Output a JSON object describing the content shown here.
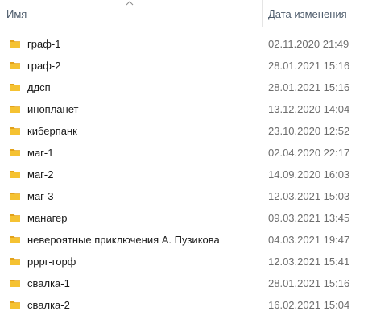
{
  "header": {
    "name_label": "Имя",
    "date_label": "Дата изменения",
    "sort_icon": "chevron-up-icon"
  },
  "colors": {
    "folder_fill": "#f5c232",
    "folder_tab": "#e3a21a",
    "header_text": "#4d5b6b",
    "date_text": "#6d6d6d"
  },
  "files": [
    {
      "name": "граф-1",
      "date": "02.11.2020 21:49",
      "icon": "folder-icon"
    },
    {
      "name": "граф-2",
      "date": "28.01.2021 15:16",
      "icon": "folder-icon"
    },
    {
      "name": "ддсп",
      "date": "28.01.2021 15:16",
      "icon": "folder-icon"
    },
    {
      "name": "инопланет",
      "date": "13.12.2020 14:04",
      "icon": "folder-icon"
    },
    {
      "name": "киберпанк",
      "date": "23.10.2020 12:52",
      "icon": "folder-icon"
    },
    {
      "name": "маг-1",
      "date": "02.04.2020 22:17",
      "icon": "folder-icon"
    },
    {
      "name": "маг-2",
      "date": "14.09.2020 16:03",
      "icon": "folder-icon"
    },
    {
      "name": "маг-3",
      "date": "12.03.2021 15:03",
      "icon": "folder-icon"
    },
    {
      "name": "манагер",
      "date": "09.03.2021 13:45",
      "icon": "folder-icon"
    },
    {
      "name": "невероятные приключения А. Пузикова",
      "date": "04.03.2021 19:47",
      "icon": "folder-icon"
    },
    {
      "name": "рррг-горф",
      "date": "12.03.2021 15:41",
      "icon": "folder-icon"
    },
    {
      "name": "свалка-1",
      "date": "28.01.2021 15:16",
      "icon": "folder-icon"
    },
    {
      "name": "свалка-2",
      "date": "16.02.2021 15:04",
      "icon": "folder-icon"
    }
  ]
}
